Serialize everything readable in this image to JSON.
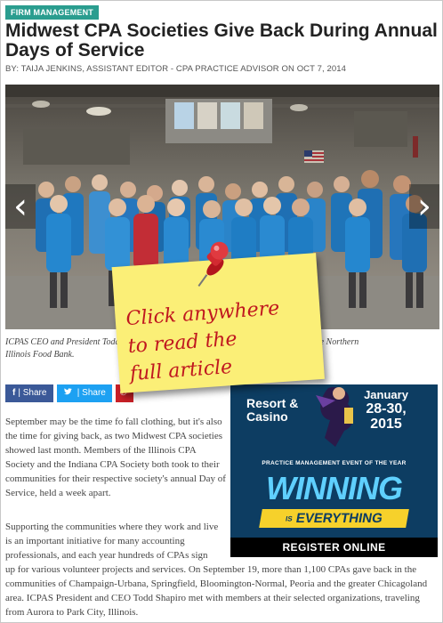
{
  "article": {
    "category": "FIRM MANAGEMENT",
    "title": "Midwest CPA Societies Give Back During Annual Days of Service",
    "byline": "BY: TAIJA JENKINS, ASSISTANT EDITOR - CPA PRACTICE ADVISOR ON OCT 7, 2014",
    "caption_left": "ICPAS CEO and President Todd",
    "caption_right": "rg & Rothblatt at the Northern",
    "caption_line2": "Illinois Food Bank.",
    "p1": "September may be the time fo fall clothing, but it's also the time for giving back, as two Midwest CPA societies showed last month. Members of the Illinois CPA Society and the Indiana CPA Society both took to their communities for their respective society's annual Day of Service, held a week apart.",
    "p2": "Supporting the communities where they work and live is an important initiative for many accounting professionals, and each year hundreds of CPAs sign",
    "p3": "up for various volunteer projects and services. On September 19, more than 1,100 CPAs gave back in the communities of Champaign-Urbana, Springfield, Bloomington-Normal, Peoria and the greater Chicagoland area. ICPAS President and CEO Todd Shapiro met with members at their selected organizations, traveling from Aurora to Park City, Illinois."
  },
  "slider": {
    "prev_icon": "chevron-left-icon",
    "next_icon": "chevron-right-icon",
    "prev_glyph": "‹",
    "next_glyph": "›"
  },
  "share": {
    "facebook_icon": "f",
    "facebook_label": "| Share",
    "twitter_icon": "🐦",
    "twitter_label": "| Share",
    "pinterest_icon": "℗"
  },
  "ad": {
    "resort_line1": "Resort &",
    "resort_line2": "Casino",
    "date_line1": "January",
    "date_line2": "28-30,",
    "date_line3": "2015",
    "event": "PRACTICE MANAGEMENT EVENT OF THE YEAR",
    "winning": "WINNING",
    "is_word": "IS",
    "everything": "EVERYTHING",
    "register": "REGISTER ONLINE"
  },
  "overlay": {
    "note_line1": "Click anywhere",
    "note_line2": "to read the",
    "note_line3": "full article"
  },
  "colors": {
    "badge": "#2a9d8f",
    "facebook": "#3b5998",
    "twitter": "#1da1f2",
    "pinterest": "#cb2027",
    "ad_bg": "#0d3d62",
    "sticky": "#fbef77",
    "sticky_text": "#c0171f"
  }
}
